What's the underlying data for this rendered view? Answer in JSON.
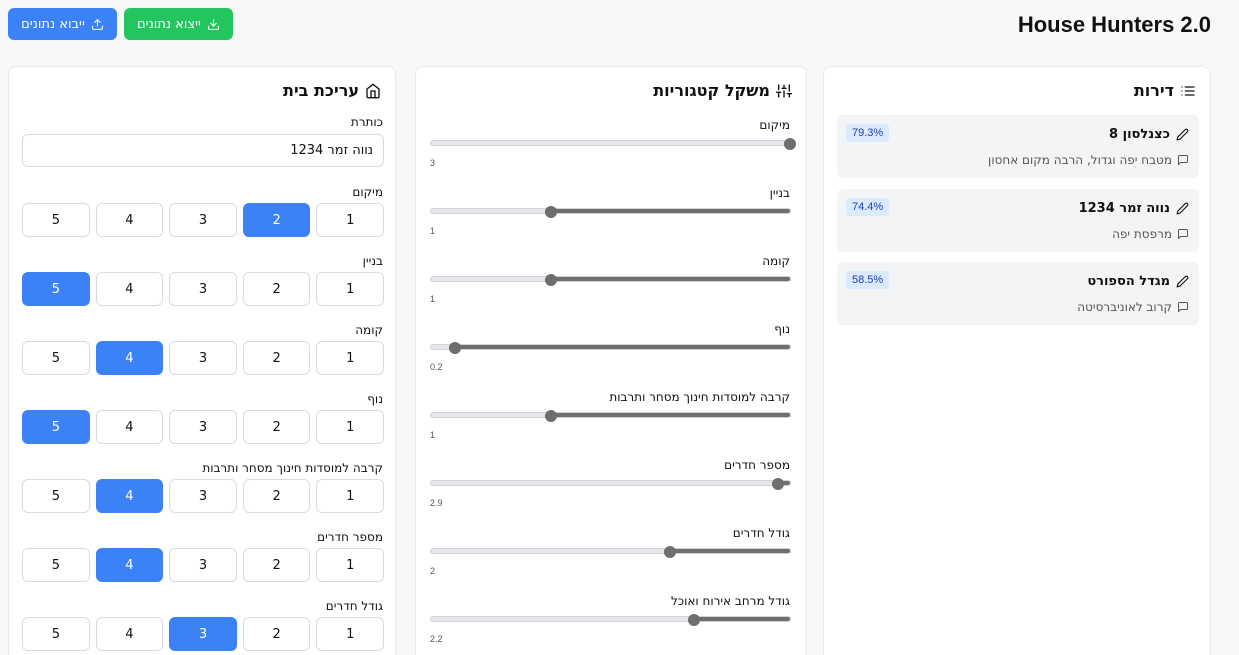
{
  "header": {
    "title": "House Hunters 2.0",
    "export_label": "ייצוא נתונים",
    "import_label": "ייבוא נתונים",
    "export_color": "#22c55e",
    "import_color": "#3b82f6"
  },
  "edit": {
    "heading": "עריכת בית",
    "title_label": "כותרת",
    "title_value": "נווה זמר 1234",
    "options": [
      "1",
      "2",
      "3",
      "4",
      "5"
    ],
    "categories": [
      {
        "label": "מיקום",
        "selected": 2
      },
      {
        "label": "בניין",
        "selected": 5
      },
      {
        "label": "קומה",
        "selected": 4
      },
      {
        "label": "נוף",
        "selected": 5
      },
      {
        "label": "קרבה למוסדות חינוך מסחר ותרבות",
        "selected": 4
      },
      {
        "label": "מספר חדרים",
        "selected": 4
      },
      {
        "label": "גודל חדרים",
        "selected": 3
      }
    ]
  },
  "weights": {
    "heading": "משקל קטגוריות",
    "min": 0,
    "max": 3,
    "items": [
      {
        "label": "מיקום",
        "value": "3",
        "num": 3
      },
      {
        "label": "בניין",
        "value": "1",
        "num": 1
      },
      {
        "label": "קומה",
        "value": "1",
        "num": 1
      },
      {
        "label": "נוף",
        "value": "0.2",
        "num": 0.2
      },
      {
        "label": "קרבה למוסדות חינוך מסחר ותרבות",
        "value": "1",
        "num": 1
      },
      {
        "label": "מספר חדרים",
        "value": "2.9",
        "num": 2.9
      },
      {
        "label": "גודל חדרים",
        "value": "2",
        "num": 2
      },
      {
        "label": "גודל מרחב אירוח ואוכל",
        "value": "2.2",
        "num": 2.2
      }
    ]
  },
  "apartments": {
    "heading": "דירות",
    "items": [
      {
        "name": "כצנלסון 8",
        "note": "מטבח יפה וגדול, הרבה מקום אחסון",
        "score": "79.3%"
      },
      {
        "name": "נווה זמר 1234",
        "note": "מרפסת יפה",
        "score": "74.4%"
      },
      {
        "name": "מגדל הספורט",
        "note": "קרוב לאוניברסיטה",
        "score": "58.5%"
      }
    ]
  }
}
